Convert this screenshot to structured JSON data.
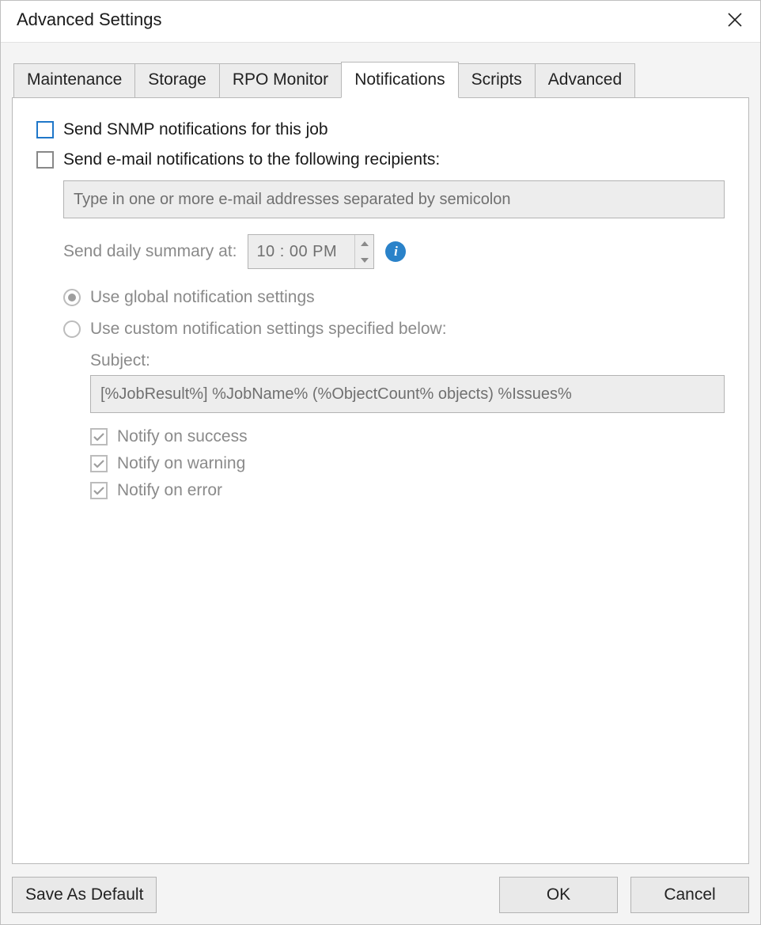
{
  "title": "Advanced Settings",
  "tabs": [
    {
      "label": "Maintenance",
      "active": false
    },
    {
      "label": "Storage",
      "active": false
    },
    {
      "label": "RPO Monitor",
      "active": false
    },
    {
      "label": "Notifications",
      "active": true
    },
    {
      "label": "Scripts",
      "active": false
    },
    {
      "label": "Advanced",
      "active": false
    }
  ],
  "notifications": {
    "snmp": {
      "label": "Send SNMP notifications for this job",
      "checked": false
    },
    "email": {
      "label": "Send e-mail notifications to the following recipients:",
      "checked": false,
      "recipients_placeholder": "Type in one or more e-mail addresses separated by semicolon",
      "recipients_value": ""
    },
    "summary": {
      "label": "Send daily summary at:",
      "time": "10 : 00 PM"
    },
    "mode": {
      "global_label": "Use global notification settings",
      "custom_label": "Use custom notification settings specified below:",
      "selected": "global"
    },
    "subject": {
      "label": "Subject:",
      "value": "[%JobResult%] %JobName% (%ObjectCount% objects) %Issues%"
    },
    "options": {
      "success": {
        "label": "Notify on success",
        "checked": true
      },
      "warning": {
        "label": "Notify on warning",
        "checked": true
      },
      "error": {
        "label": "Notify on error",
        "checked": true
      }
    }
  },
  "buttons": {
    "save_default": "Save As Default",
    "ok": "OK",
    "cancel": "Cancel"
  }
}
